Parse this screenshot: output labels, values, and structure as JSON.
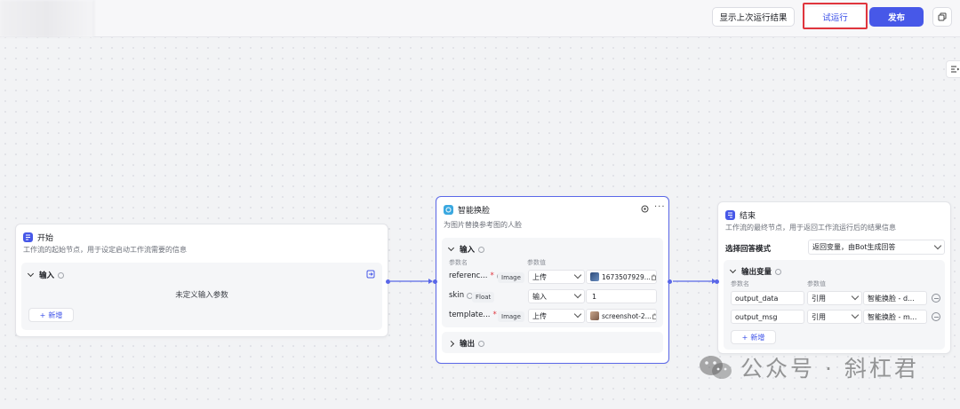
{
  "header": {
    "history_label": "显示上次运行结果",
    "trial_label": "试运行",
    "publish_label": "发布"
  },
  "start_node": {
    "title": "开始",
    "description": "工作流的起始节点，用于设定启动工作流需要的信息",
    "input_section": "输入",
    "empty_text": "未定义输入参数",
    "add_label": "新增",
    "icon_color": "#4758e8"
  },
  "face_node": {
    "title": "智能换脸",
    "description": "为图片替换参考图的人脸",
    "input_section": "输入",
    "col_name": "参数名",
    "col_value": "参数值",
    "params": [
      {
        "name": "referenc...",
        "required": true,
        "type": "Image",
        "source": "上传",
        "value": "1673507929..."
      },
      {
        "name": "skin",
        "required": false,
        "type": "Float",
        "source": "输入",
        "value": "1"
      },
      {
        "name": "template...",
        "required": true,
        "type": "Image",
        "source": "上传",
        "value": "screenshot-2..."
      }
    ],
    "output_section": "输出",
    "icon_color": "#3aa8e0"
  },
  "end_node": {
    "title": "结束",
    "description": "工作流的最终节点，用于返回工作流运行后的结果信息",
    "mode_label": "选择回答模式",
    "mode_value": "返回变量，由Bot生成回答",
    "output_section": "输出变量",
    "col_name": "参数名",
    "col_value": "参数值",
    "vars": [
      {
        "name": "output_data",
        "source": "引用",
        "value": "智能换脸 - d..."
      },
      {
        "name": "output_msg",
        "source": "引用",
        "value": "智能换脸 - m..."
      }
    ],
    "add_label": "新增",
    "icon_color": "#4758e8"
  },
  "watermark": {
    "text": "公众号 · 斜杠君"
  },
  "colors": {
    "accent": "#4758e8",
    "highlight": "#e0353d",
    "edge": "#5a67e8"
  }
}
